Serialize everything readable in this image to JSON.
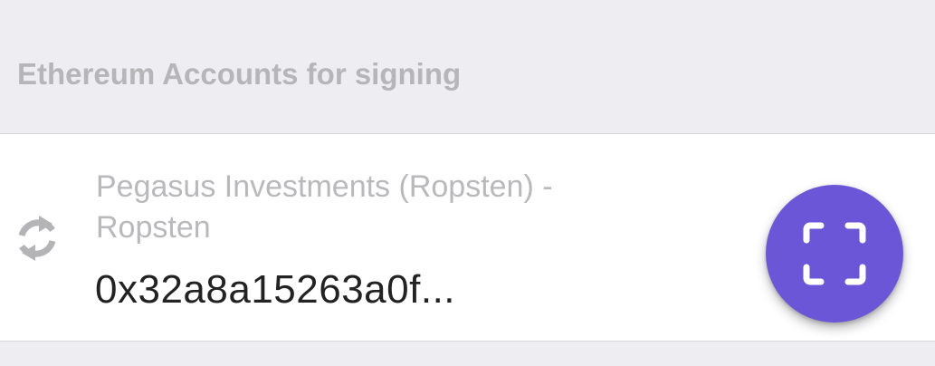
{
  "section": {
    "title": "Ethereum Accounts for signing"
  },
  "account": {
    "name": "Pegasus Investments (Ropsten) - Ropsten",
    "address": "0x32a8a15263a0f...",
    "icon": "sync-icon"
  },
  "fab": {
    "icon": "scan-qr-icon",
    "color": "#6c56d8"
  },
  "colors": {
    "background": "#eeedf2",
    "header_text": "#b6b6b9",
    "secondary_text": "#b9b9bc",
    "primary_text": "#232323",
    "accent": "#6c56d8"
  }
}
